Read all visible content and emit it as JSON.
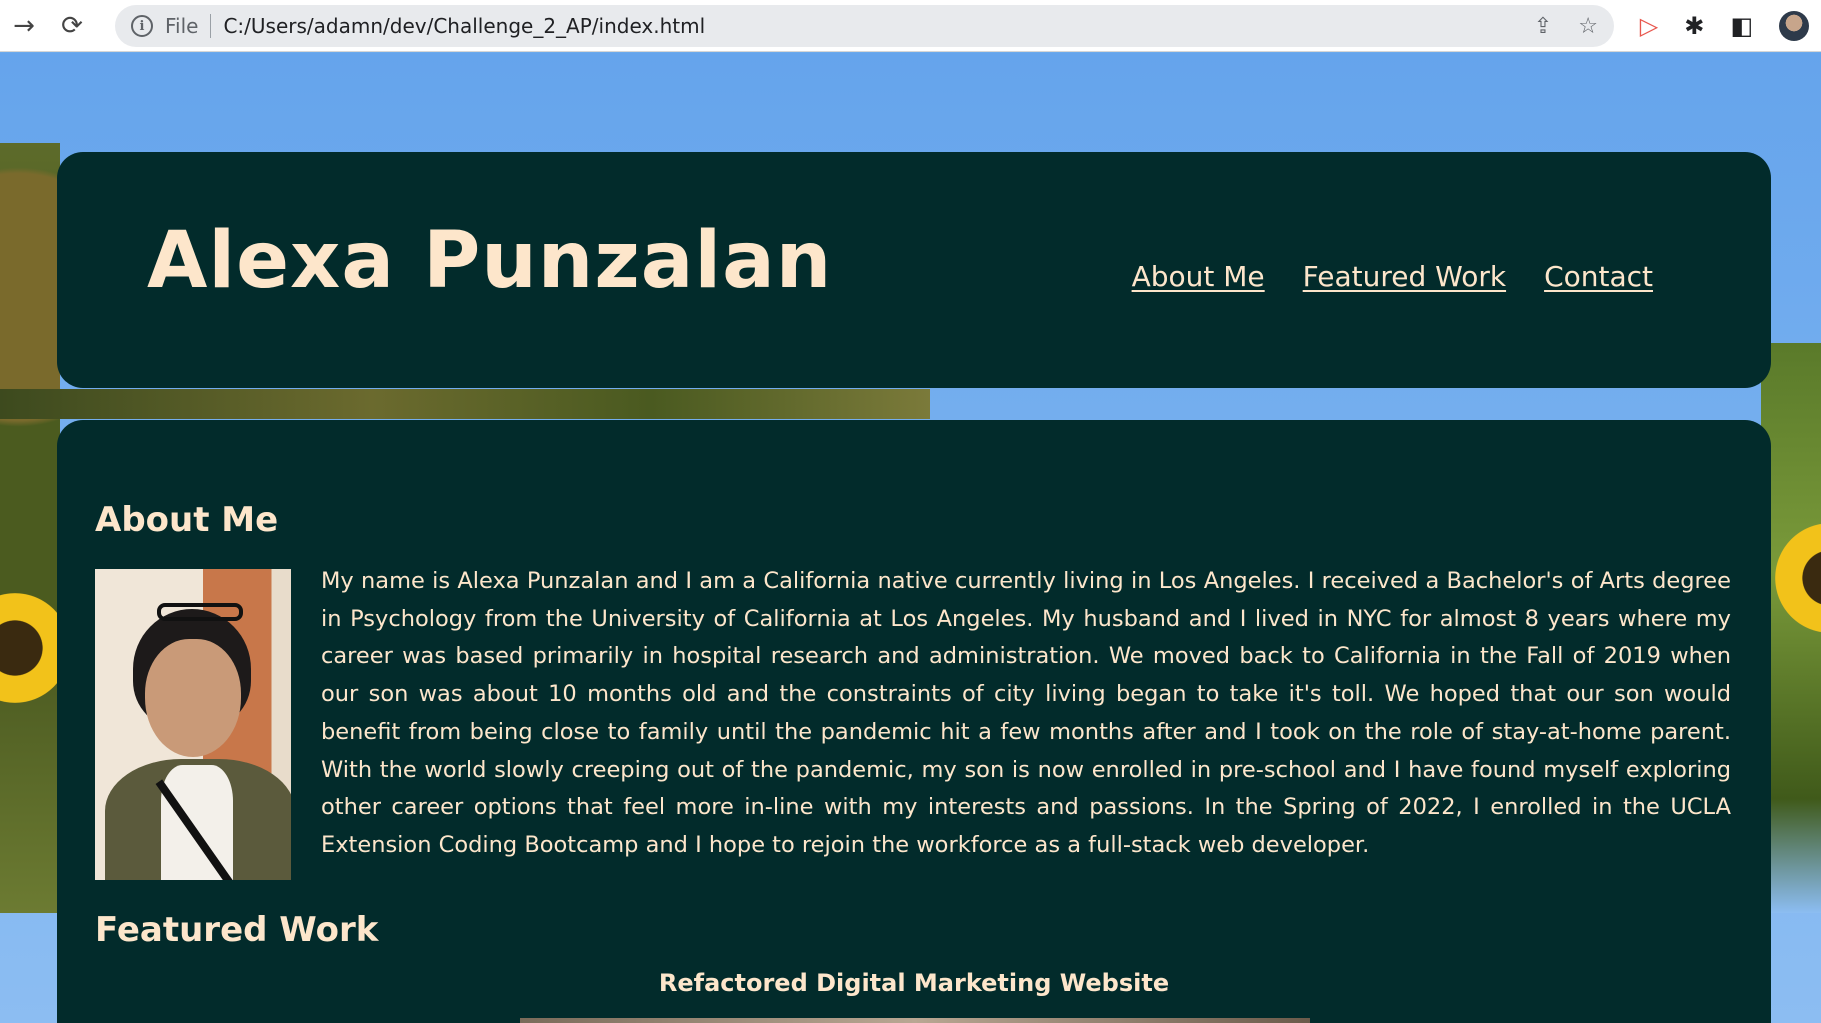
{
  "browser": {
    "scheme": "File",
    "url": "C:/Users/adamn/dev/Challenge_2_AP/index.html"
  },
  "header": {
    "title": "Alexa Punzalan",
    "nav": [
      "About Me",
      "Featured Work",
      "Contact"
    ]
  },
  "about": {
    "heading": "About Me",
    "text": "My name is Alexa Punzalan and I am a California native currently living in Los Angeles. I received a Bachelor's of Arts degree in Psychology from the University of California at Los Angeles. My husband and I lived in NYC for almost 8 years where my career was based primarily in hospital research and administration. We moved back to California in the Fall of 2019 when our son was about 10 months old and the constraints of city living began to take it's toll. We hoped that our son would benefit from being close to family until the pandemic hit a few months after and I took on the role of stay-at-home parent. With the world slowly creeping out of the pandemic, my son is now enrolled in pre-school and I have found myself exploring other career options that feel more in-line with my interests and passions. In the Spring of 2022, I enrolled in the UCLA Extension Coding Bootcamp and I hope to rejoin the workforce as a full-stack web developer."
  },
  "featured": {
    "heading": "Featured Work",
    "project_title": "Refactored Digital Marketing Website"
  },
  "colors": {
    "card": "#022b2b",
    "text": "#fde6cb"
  }
}
